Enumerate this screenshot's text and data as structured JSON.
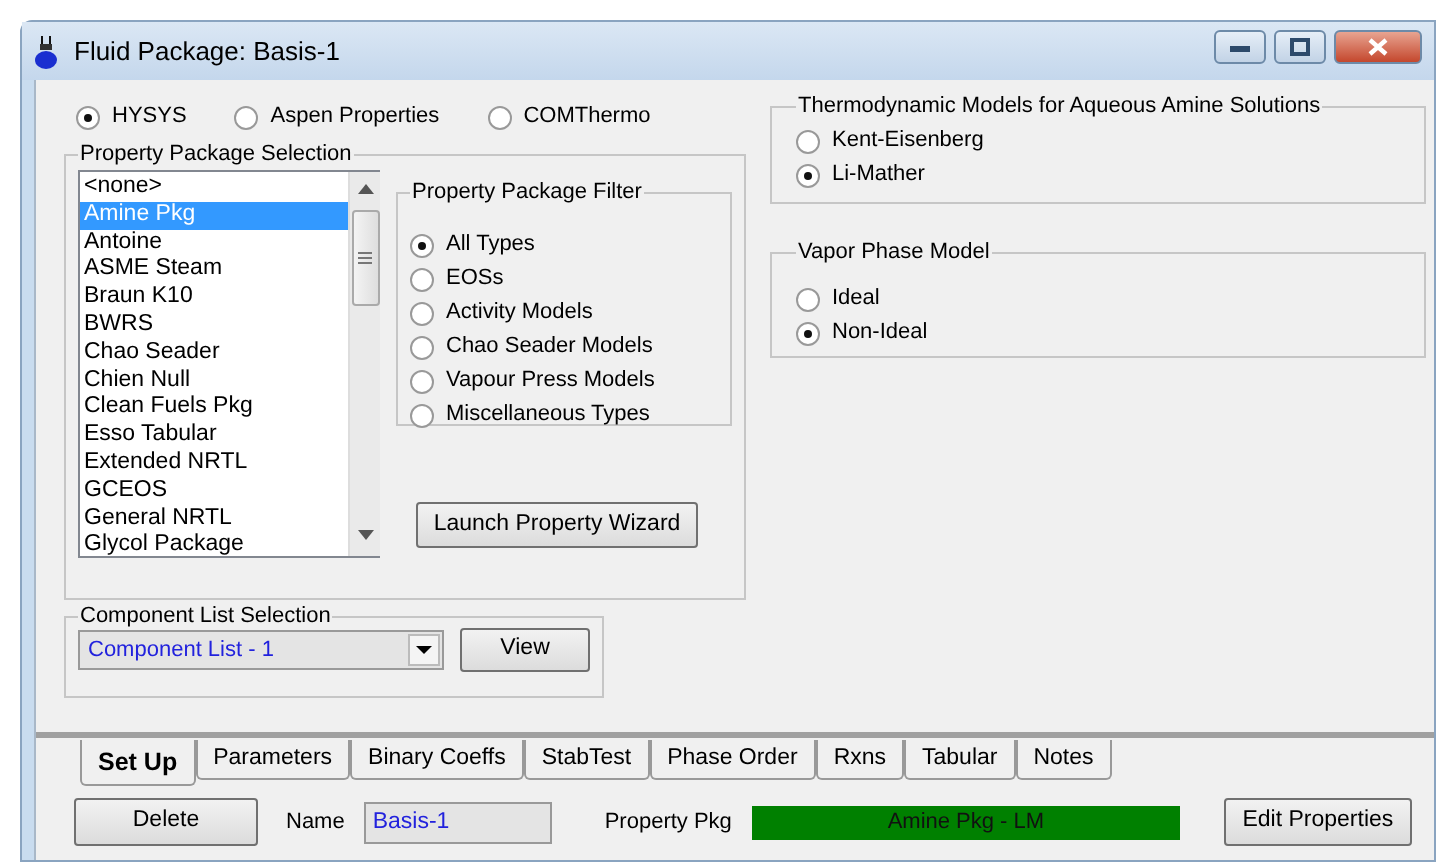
{
  "window": {
    "title": "Fluid Package: Basis-1"
  },
  "property_sources": [
    {
      "label": "HYSYS",
      "selected": true
    },
    {
      "label": "Aspen Properties",
      "selected": false
    },
    {
      "label": "COMThermo",
      "selected": false
    }
  ],
  "property_package_selection": {
    "title": "Property Package Selection",
    "items": [
      {
        "label": "<none>",
        "selected": false
      },
      {
        "label": "Amine Pkg",
        "selected": true
      },
      {
        "label": "Antoine",
        "selected": false
      },
      {
        "label": "ASME Steam",
        "selected": false
      },
      {
        "label": "Braun K10",
        "selected": false
      },
      {
        "label": "BWRS",
        "selected": false
      },
      {
        "label": "Chao Seader",
        "selected": false
      },
      {
        "label": "Chien Null",
        "selected": false
      },
      {
        "label": "Clean Fuels Pkg",
        "selected": false
      },
      {
        "label": "Esso Tabular",
        "selected": false
      },
      {
        "label": "Extended NRTL",
        "selected": false
      },
      {
        "label": "GCEOS",
        "selected": false
      },
      {
        "label": "General NRTL",
        "selected": false
      },
      {
        "label": "Glycol Package",
        "selected": false
      }
    ]
  },
  "property_package_filter": {
    "title": "Property Package Filter",
    "options": [
      {
        "label": "All Types",
        "selected": true
      },
      {
        "label": "EOSs",
        "selected": false
      },
      {
        "label": "Activity Models",
        "selected": false
      },
      {
        "label": "Chao Seader Models",
        "selected": false
      },
      {
        "label": "Vapour Press Models",
        "selected": false
      },
      {
        "label": "Miscellaneous Types",
        "selected": false
      }
    ]
  },
  "launch_button": "Launch Property Wizard",
  "component_list_selection": {
    "title": "Component List Selection",
    "value": "Component List - 1",
    "button": "View"
  },
  "thermodynamic_models": {
    "title": "Thermodynamic Models for Aqueous Amine Solutions",
    "options": [
      {
        "label": "Kent-Eisenberg",
        "selected": false
      },
      {
        "label": "Li-Mather",
        "selected": true
      }
    ]
  },
  "vapor_phase_model": {
    "title": "Vapor Phase Model",
    "options": [
      {
        "label": "Ideal",
        "selected": false
      },
      {
        "label": "Non-Ideal",
        "selected": true
      }
    ]
  },
  "tabs": [
    {
      "label": "Set Up",
      "selected": true
    },
    {
      "label": "Parameters",
      "selected": false
    },
    {
      "label": "Binary Coeffs",
      "selected": false
    },
    {
      "label": "StabTest",
      "selected": false
    },
    {
      "label": "Phase Order",
      "selected": false
    },
    {
      "label": "Rxns",
      "selected": false
    },
    {
      "label": "Tabular",
      "selected": false
    },
    {
      "label": "Notes",
      "selected": false
    }
  ],
  "footer": {
    "delete_button": "Delete",
    "name_label": "Name",
    "name_value": "Basis-1",
    "property_pkg_label": "Property Pkg",
    "property_pkg_value": "Amine Pkg - LM",
    "edit_button": "Edit Properties"
  }
}
